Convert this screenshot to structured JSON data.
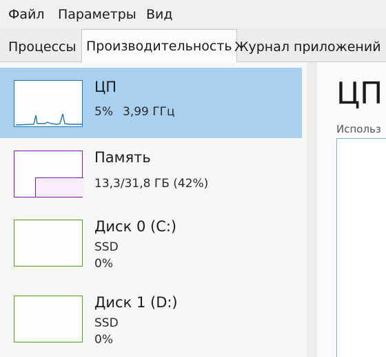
{
  "menu": {
    "file": "Файл",
    "options": "Параметры",
    "view": "Вид"
  },
  "tabs": {
    "processes": "Процессы",
    "performance": "Производительность",
    "app_history": "Журнал приложений"
  },
  "sidebar": {
    "cpu": {
      "title": "ЦП",
      "usage": "5%",
      "speed": "3,99 ГГц"
    },
    "memory": {
      "title": "Память",
      "detail": "13,3/31,8 ГБ (42%)",
      "usage_fraction": 0.42
    },
    "disk0": {
      "title": "Диск 0 (C:)",
      "type": "SSD",
      "usage": "0%"
    },
    "disk1": {
      "title": "Диск 1 (D:)",
      "type": "SSD",
      "usage": "0%"
    }
  },
  "main": {
    "title": "ЦП",
    "subtitle": "Использ"
  },
  "colors": {
    "selected": "#a9d0ee",
    "cpu": "#1b75bb",
    "memory": "#8b12ae",
    "disk": "#4da60c"
  }
}
